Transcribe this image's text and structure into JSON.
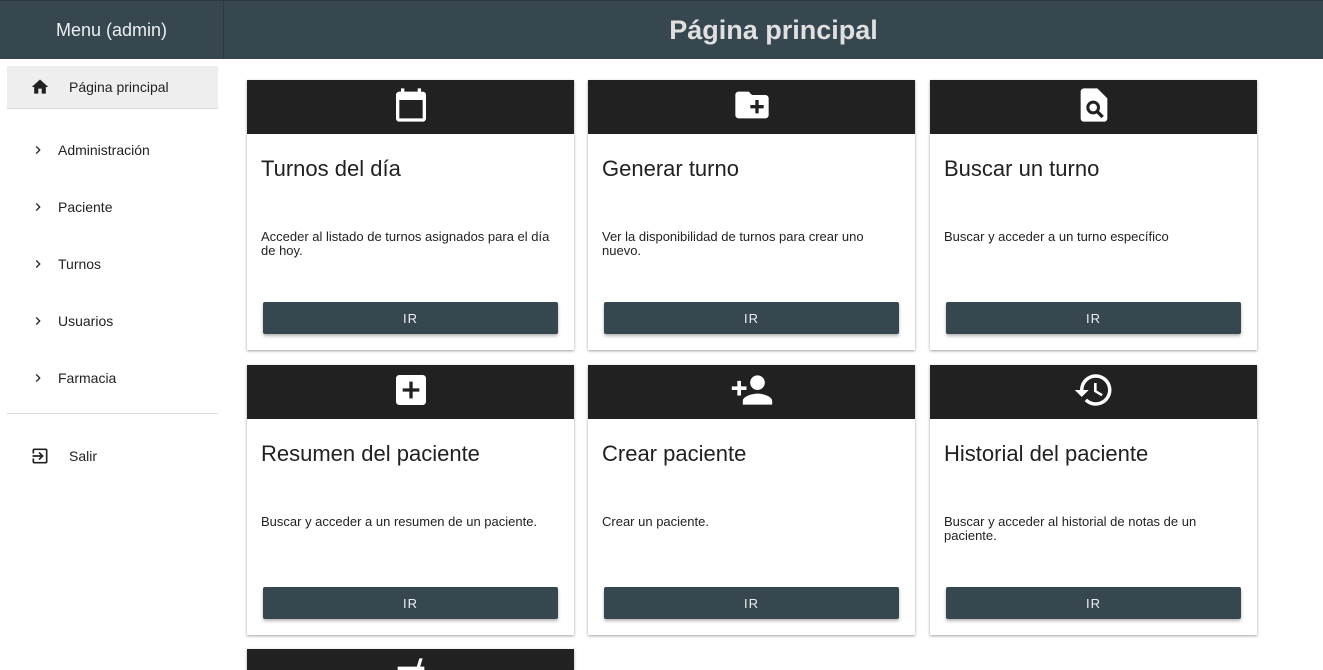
{
  "header": {
    "menu_title": "Menu (admin)",
    "page_title": "Página principal"
  },
  "sidebar": {
    "home": {
      "label": "Página principal",
      "icon": "home-icon"
    },
    "items": [
      {
        "label": "Administración",
        "icon": "chevron-right-icon"
      },
      {
        "label": "Paciente",
        "icon": "chevron-right-icon"
      },
      {
        "label": "Turnos",
        "icon": "chevron-right-icon"
      },
      {
        "label": "Usuarios",
        "icon": "chevron-right-icon"
      },
      {
        "label": "Farmacia",
        "icon": "chevron-right-icon"
      }
    ],
    "logout": {
      "label": "Salir",
      "icon": "logout-icon"
    }
  },
  "cards": [
    {
      "title": "Turnos del día",
      "description": "Acceder al listado de turnos asignados para el día de hoy.",
      "button": "IR",
      "icon": "calendar-icon"
    },
    {
      "title": "Generar turno",
      "description": "Ver la disponibilidad de turnos para crear uno nuevo.",
      "button": "IR",
      "icon": "folder-add-icon"
    },
    {
      "title": "Buscar un turno",
      "description": "Buscar y acceder a un turno específico",
      "button": "IR",
      "icon": "document-search-icon"
    },
    {
      "title": "Resumen del paciente",
      "description": "Buscar y acceder a un resumen de un paciente.",
      "button": "IR",
      "icon": "medical-cross-icon"
    },
    {
      "title": "Crear paciente",
      "description": "Crear un paciente.",
      "button": "IR",
      "icon": "person-add-icon"
    },
    {
      "title": "Historial del paciente",
      "description": "Buscar y acceder al historial de notas de un paciente.",
      "button": "IR",
      "icon": "history-icon"
    },
    {
      "title": "",
      "description": "",
      "button": "",
      "icon": "mortar-pestle-icon"
    }
  ],
  "colors": {
    "header_bg": "#37474f",
    "card_head_bg": "#212121",
    "button_bg": "#37474f"
  }
}
